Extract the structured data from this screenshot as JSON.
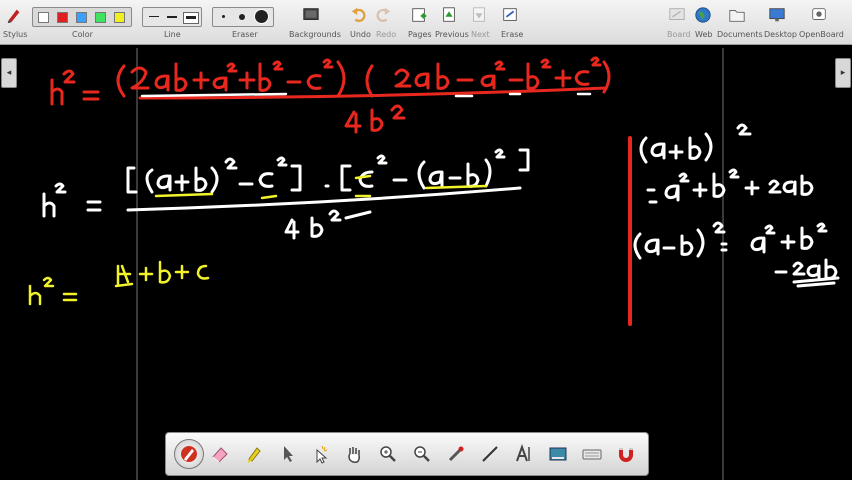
{
  "toolbar": {
    "stylus_label": "Stylus",
    "color_label": "Color",
    "line_label": "Line",
    "eraser_label": "Eraser",
    "backgrounds_label": "Backgrounds",
    "undo_label": "Undo",
    "redo_label": "Redo",
    "pages_label": "Pages",
    "previous_label": "Previous",
    "next_label": "Next",
    "erase_label": "Erase",
    "board_label": "Board",
    "web_label": "Web",
    "documents_label": "Documents",
    "desktop_label": "Desktop",
    "openboard_label": "OpenBoard",
    "colors": [
      "#ffffff",
      "#e02020",
      "#39a0ff",
      "#40e060",
      "#f0f020"
    ]
  },
  "side_tabs": {
    "left": "◂",
    "right": "▸"
  },
  "bottom_tools": [
    "pen-icon",
    "eraser-icon",
    "marker-icon",
    "selector-icon",
    "play-icon",
    "hand-icon",
    "zoom-in-icon",
    "zoom-out-icon",
    "laser-pointer-icon",
    "line-icon",
    "text-icon",
    "capture-icon",
    "virtual-keyboard-icon",
    "magnet-icon"
  ],
  "ink_colors": {
    "red": "#e8281e",
    "white": "#ffffff",
    "yellow": "#f2f22a"
  }
}
